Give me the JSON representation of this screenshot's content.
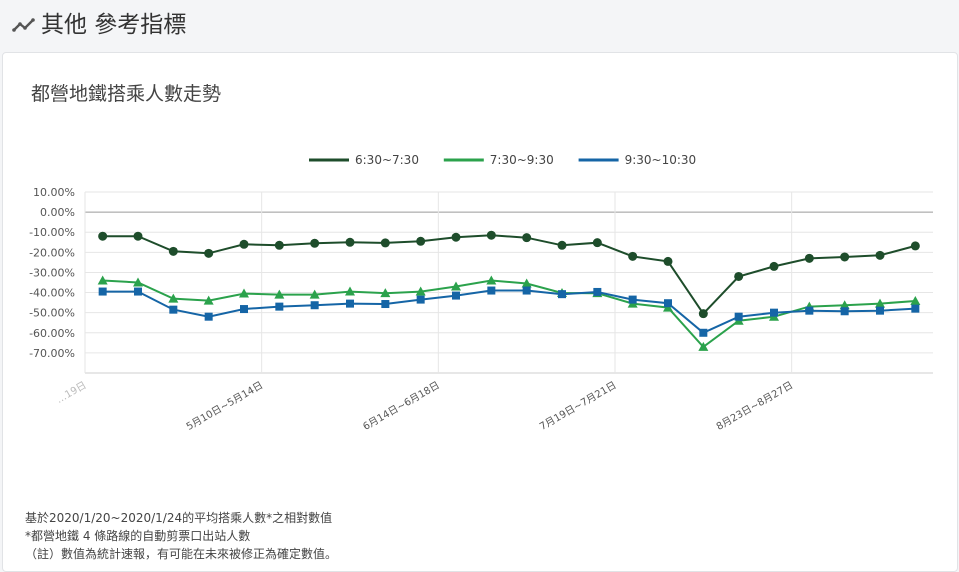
{
  "section": {
    "title": "其他 參考指標",
    "icon": "trend-line-icon"
  },
  "card": {
    "title": "都營地鐵搭乘人數走勢"
  },
  "notes": [
    "基於2020/1/20~2020/1/24的平均搭乘人數*之相對數值",
    "*都營地鐵 4 條路線的自動剪票口出站人數",
    "（註）數值為統計速報，有可能在未來被修正為確定數值。"
  ],
  "chart_data": {
    "type": "line",
    "xlabel": "",
    "ylabel": "",
    "ylim": [
      -80,
      10
    ],
    "ytick_labels": [
      "10.00%",
      "0.00%",
      "-10.00%",
      "-20.00%",
      "-30.00%",
      "-40.00%",
      "-50.00%",
      "-60.00%",
      "-70.00%"
    ],
    "yticks": [
      10,
      0,
      -10,
      -20,
      -30,
      -40,
      -50,
      -60,
      -70
    ],
    "x_tick_labels": [
      {
        "index": 0,
        "label": "…19日"
      },
      {
        "index": 5,
        "label": "5月10日~5月14日"
      },
      {
        "index": 10,
        "label": "6月14日~6月18日"
      },
      {
        "index": 15,
        "label": "7月19日~7月21日"
      },
      {
        "index": 20,
        "label": "8月23日~8月27日"
      }
    ],
    "grid": true,
    "legend_position": "top",
    "series": [
      {
        "name": "6:30~7:30",
        "color": "#1e4d2b",
        "marker": "circle",
        "values": [
          -12,
          -12,
          -19.5,
          -20.5,
          -16,
          -16.5,
          -15.5,
          -15,
          -15.3,
          -14.5,
          -12.5,
          -11.5,
          -12.7,
          -16.5,
          -15.2,
          -22,
          -24.5,
          -50.5,
          -32,
          -27,
          -23,
          -22.3,
          -21.5,
          -16.8
        ]
      },
      {
        "name": "7:30~9:30",
        "color": "#2ba24c",
        "marker": "triangle",
        "values": [
          -34,
          -35,
          -43,
          -44,
          -40.5,
          -41,
          -41,
          -39.5,
          -40.3,
          -39.5,
          -37,
          -34,
          -35.5,
          -40.2,
          -40.3,
          -45.5,
          -47.5,
          -67,
          -54,
          -52,
          -47,
          -46.3,
          -45.5,
          -44.2
        ]
      },
      {
        "name": "9:30~10:30",
        "color": "#1565a6",
        "marker": "square",
        "values": [
          -39.5,
          -39.5,
          -48.5,
          -52,
          -48.2,
          -47,
          -46.3,
          -45.5,
          -45.7,
          -43.5,
          -41.5,
          -39,
          -39,
          -40.8,
          -39.7,
          -43.5,
          -45.3,
          -60,
          -52,
          -50,
          -49,
          -49.3,
          -49,
          -48
        ]
      }
    ]
  }
}
